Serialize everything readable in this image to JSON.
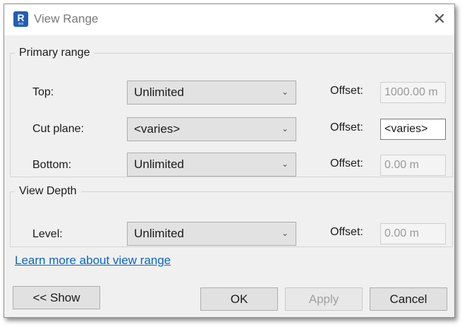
{
  "window": {
    "title": "View Range",
    "close_glyph": "✕",
    "app_icon_letter": "R",
    "app_icon_sub": "xxx"
  },
  "primary_range": {
    "legend": "Primary range",
    "rows": [
      {
        "label": "Top:",
        "value": "Unlimited",
        "offset_label": "Offset:",
        "offset_value": "1000.00 m",
        "offset_enabled": false
      },
      {
        "label": "Cut plane:",
        "value": "<varies>",
        "offset_label": "Offset:",
        "offset_value": "<varies>",
        "offset_enabled": true
      },
      {
        "label": "Bottom:",
        "value": "Unlimited",
        "offset_label": "Offset:",
        "offset_value": "0.00 m",
        "offset_enabled": false
      }
    ]
  },
  "view_depth": {
    "legend": "View Depth",
    "rows": [
      {
        "label": "Level:",
        "value": "Unlimited",
        "offset_label": "Offset:",
        "offset_value": "0.00 m",
        "offset_enabled": false
      }
    ]
  },
  "link": {
    "label": "Learn more about view range"
  },
  "buttons": {
    "show": "<< Show",
    "ok": "OK",
    "apply": "Apply",
    "cancel": "Cancel"
  },
  "icons": {
    "dropdown": "chevron-down-icon",
    "close": "close-icon",
    "app": "revit-app-icon"
  },
  "colors": {
    "link": "#0b66c3",
    "app_icon": "#1f5fb4",
    "dialog_bg": "#f0f0f0"
  }
}
